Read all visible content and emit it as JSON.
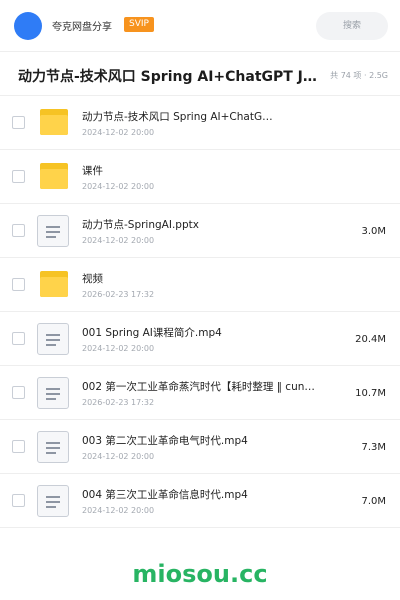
{
  "header": {
    "owner_name": "夸克网盘分享",
    "badge": "SVIP",
    "search_placeholder": "搜索"
  },
  "folder": {
    "title": "动力节点-技术风口 Spring AI+ChatGPT J…",
    "meta": "共 74 项 · 2.5G"
  },
  "items": [
    {
      "type": "folder",
      "name": "动力节点-技术风口 Spring AI+ChatG…",
      "date": "2024-12-02 20:00",
      "size": ""
    },
    {
      "type": "folder",
      "name": "课件",
      "date": "2024-12-02 20:00",
      "size": ""
    },
    {
      "type": "file",
      "name": "动力节点-SpringAI.pptx",
      "date": "2024-12-02 20:00",
      "size": "3.0M"
    },
    {
      "type": "folder",
      "name": "视频",
      "date": "2026-02-23 17:32",
      "size": ""
    },
    {
      "type": "file",
      "name": "001 Spring AI课程简介.mp4",
      "date": "2024-12-02 20:00",
      "size": "20.4M"
    },
    {
      "type": "file",
      "name": "002 第一次工业革命蒸汽时代【耗时整理 ‖ cun…",
      "date": "2026-02-23 17:32",
      "size": "10.7M"
    },
    {
      "type": "file",
      "name": "003 第二次工业革命电气时代.mp4",
      "date": "2024-12-02 20:00",
      "size": "7.3M"
    },
    {
      "type": "file",
      "name": "004 第三次工业革命信息时代.mp4",
      "date": "2024-12-02 20:00",
      "size": "7.0M"
    }
  ],
  "watermark": "miosou.cc",
  "colors": {
    "accent": "#2f7cf6",
    "badge": "#f7931e",
    "folder": "#ffd34a",
    "watermark": "#28b463"
  }
}
